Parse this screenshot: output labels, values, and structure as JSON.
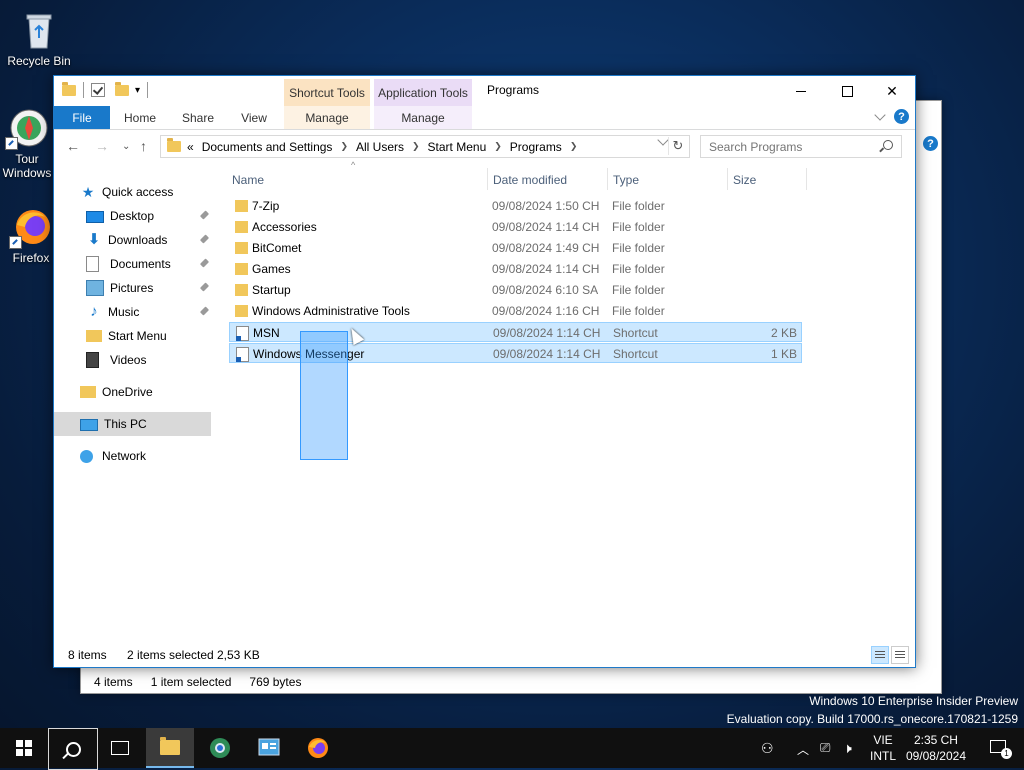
{
  "desktop": {
    "icons": [
      {
        "label": "Recycle Bin"
      },
      {
        "label": "Tour Windows"
      },
      {
        "label": "Firefox"
      }
    ]
  },
  "bg_window": {
    "status": {
      "items_count": "4 items",
      "selection": "1 item selected",
      "size": "769 bytes"
    }
  },
  "window": {
    "title": "Programs",
    "context_tabs": {
      "shortcut_tools": "Shortcut Tools",
      "application_tools": "Application Tools"
    },
    "ribbon_tabs": {
      "file": "File",
      "home": "Home",
      "share": "Share",
      "view": "View",
      "manage1": "Manage",
      "manage2": "Manage"
    },
    "address": {
      "overflow": "«",
      "crumbs": [
        "Documents and Settings",
        "All Users",
        "Start Menu",
        "Programs"
      ]
    },
    "search": {
      "placeholder": "Search Programs"
    },
    "nav_pane": {
      "quick_access": "Quick access",
      "items": [
        "Desktop",
        "Downloads",
        "Documents",
        "Pictures",
        "Music",
        "Start Menu",
        "Videos"
      ],
      "onedrive": "OneDrive",
      "this_pc": "This PC",
      "network": "Network"
    },
    "columns": {
      "name": "Name",
      "date": "Date modified",
      "type": "Type",
      "size": "Size"
    },
    "files": [
      {
        "name": "7-Zip",
        "date": "09/08/2024 1:50 CH",
        "type": "File folder",
        "size": ""
      },
      {
        "name": "Accessories",
        "date": "09/08/2024 1:14 CH",
        "type": "File folder",
        "size": ""
      },
      {
        "name": "BitComet",
        "date": "09/08/2024 1:49 CH",
        "type": "File folder",
        "size": ""
      },
      {
        "name": "Games",
        "date": "09/08/2024 1:14 CH",
        "type": "File folder",
        "size": ""
      },
      {
        "name": "Startup",
        "date": "09/08/2024 6:10 SA",
        "type": "File folder",
        "size": ""
      },
      {
        "name": "Windows Administrative Tools",
        "date": "09/08/2024 1:16 CH",
        "type": "File folder",
        "size": ""
      },
      {
        "name": "MSN",
        "date": "09/08/2024 1:14 CH",
        "type": "Shortcut",
        "size": "2 KB"
      },
      {
        "name": "Windows Messenger",
        "date": "09/08/2024 1:14 CH",
        "type": "Shortcut",
        "size": "1 KB"
      }
    ],
    "status": {
      "items_count": "8 items",
      "selection": "2 items selected",
      "size": "2,53 KB"
    }
  },
  "watermark": {
    "line1": "Windows 10 Enterprise Insider Preview",
    "line2": "Evaluation copy. Build 17000.rs_onecore.170821-1259"
  },
  "taskbar": {
    "lang_top": "VIE",
    "lang_bottom": "INTL",
    "time": "2:35 CH",
    "date": "09/08/2024",
    "notification_count": "1"
  }
}
